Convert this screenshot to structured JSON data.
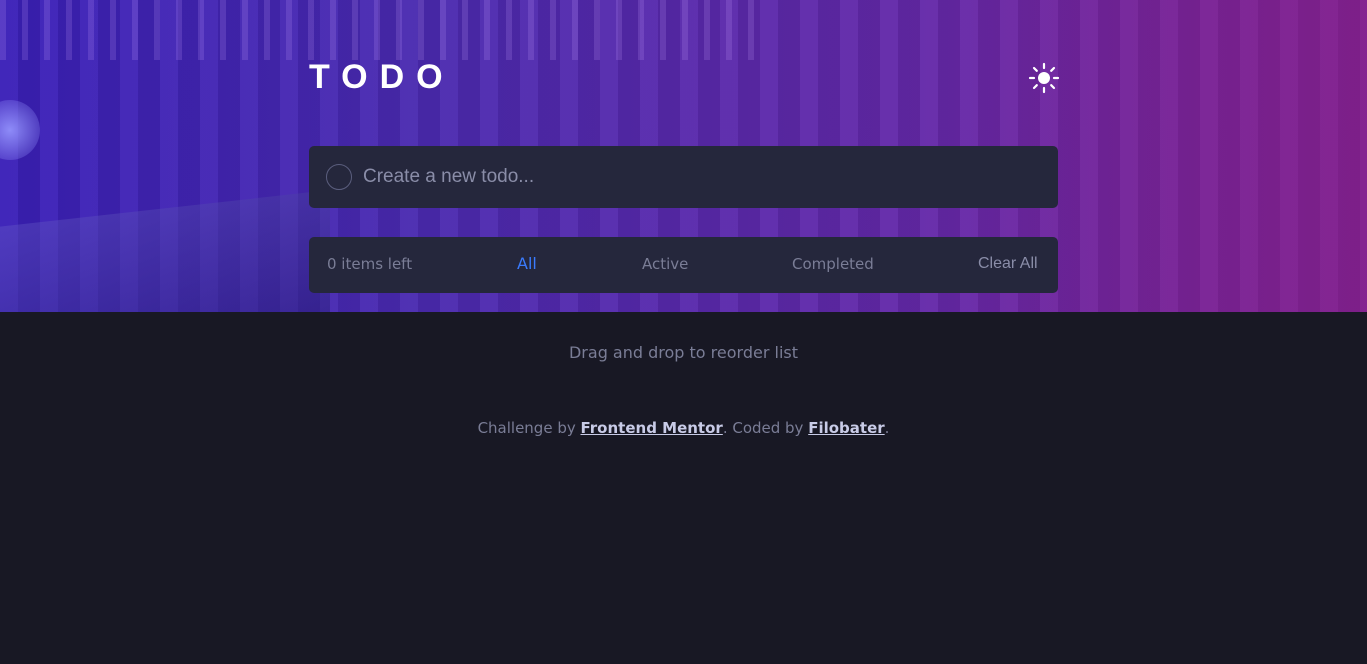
{
  "app": {
    "title": "TODO",
    "theme_toggle_icon": "sun-icon"
  },
  "new_todo": {
    "placeholder": "Create a new todo...",
    "value": ""
  },
  "footer_bar": {
    "items_left": "0 items left",
    "filters": [
      "All",
      "Active",
      "Completed"
    ],
    "selected_filter": "All",
    "clear_label": "Clear All"
  },
  "hint": "Drag and drop to reorder list",
  "attribution": {
    "prefix": "Challenge by ",
    "link1": "Frontend Mentor",
    "middle": ". Coded by ",
    "link2": "Filobater",
    "suffix": "."
  },
  "colors": {
    "background": "#181824",
    "panel": "#25273c",
    "accent": "#3a7bfd",
    "muted_text": "#7a7d96"
  }
}
